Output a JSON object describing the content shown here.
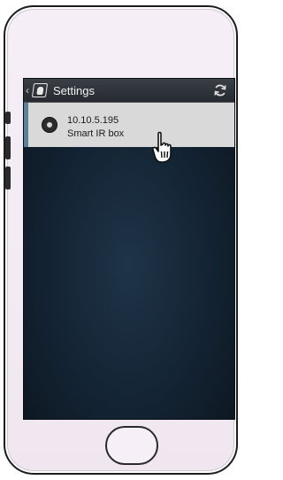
{
  "actionbar": {
    "back_glyph": "‹",
    "title": "Settings",
    "app_icon": "device-icon",
    "refresh_icon": "refresh-icon"
  },
  "devices": [
    {
      "ip": "10.10.5.195",
      "name": "Smart IR box",
      "selected": true
    }
  ],
  "colors": {
    "screen_bg": "#152637",
    "actionbar_bg": "#2f3339",
    "item_bg": "#d9d9d9",
    "accent": "#5d7f9b"
  }
}
